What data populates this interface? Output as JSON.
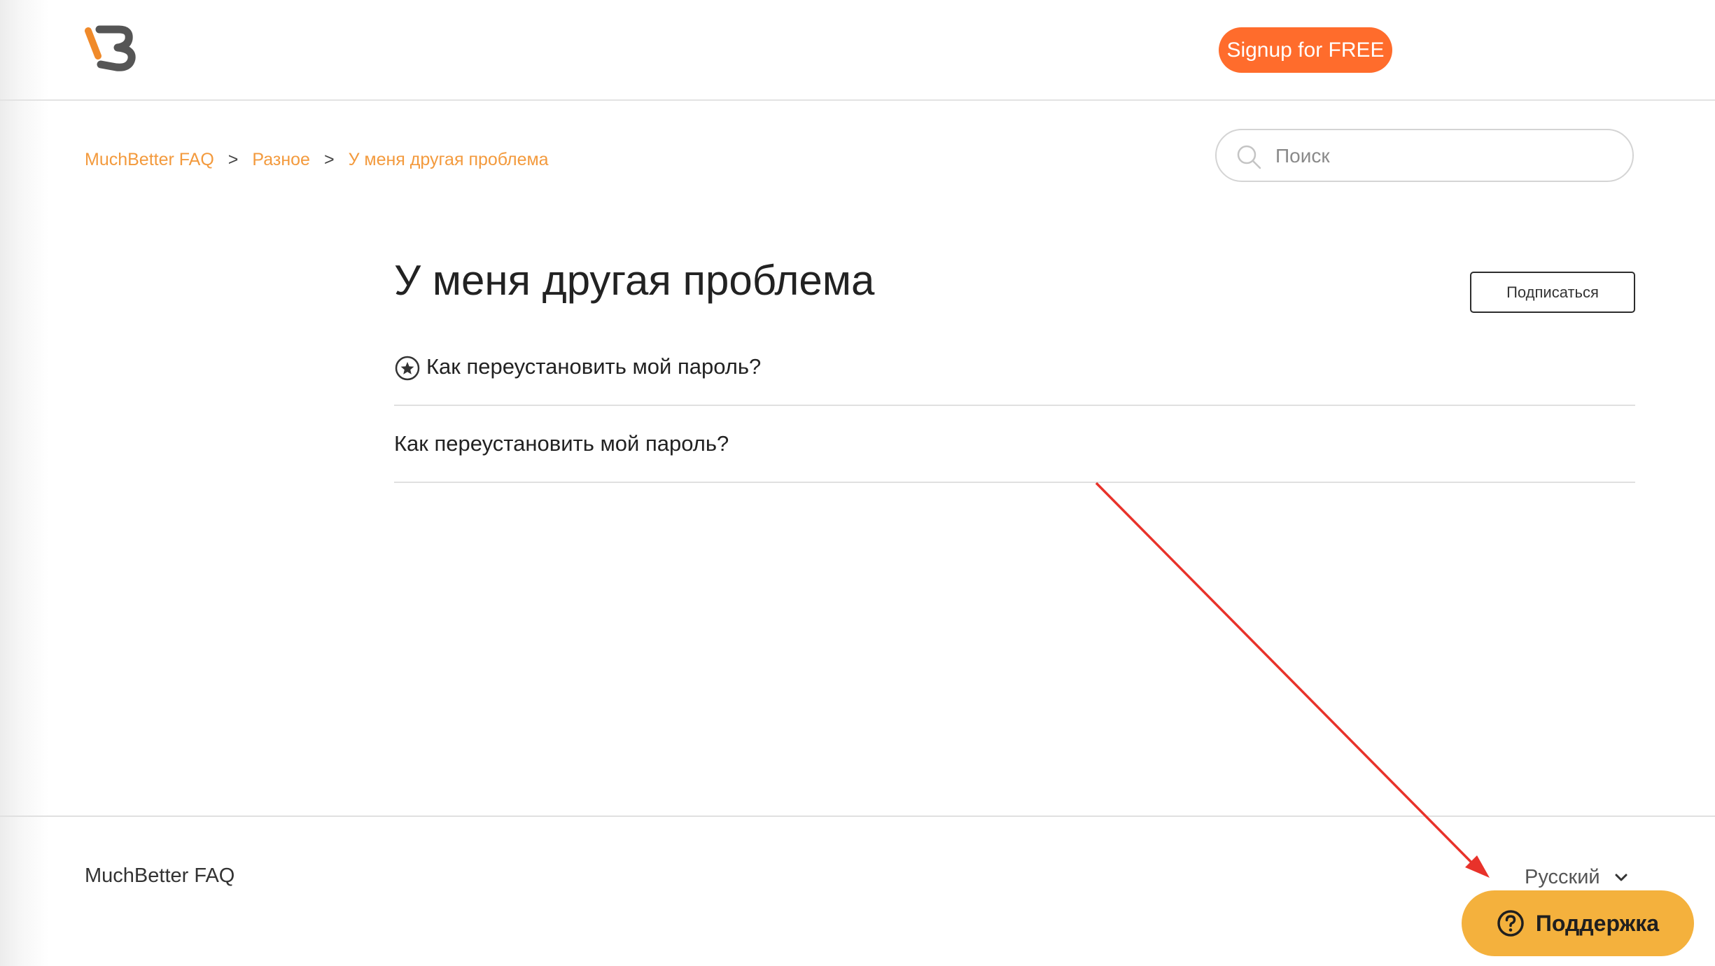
{
  "header": {
    "logo_icon": "muchbetter-logo-icon",
    "signup_label": "Signup for FREE",
    "accent_color": "#ff6c2c"
  },
  "breadcrumb": {
    "items": [
      "MuchBetter FAQ",
      "Разное",
      "У меня другая проблема"
    ],
    "separator": ">"
  },
  "search": {
    "placeholder": "Поиск",
    "icon": "search-icon"
  },
  "section": {
    "title": "У меня другая проблема",
    "subscribe_label": "Подписаться"
  },
  "articles": [
    {
      "title": "Как переустановить мой пароль?",
      "icon": "star-icon",
      "promoted": true
    },
    {
      "title": "Как переустановить мой пароль?"
    }
  ],
  "footer": {
    "title": "MuchBetter FAQ",
    "language": "Русский"
  },
  "support": {
    "label": "Поддержка",
    "icon": "question-circle-icon",
    "color": "#f4b13d"
  },
  "annotation_color": "#e8322a"
}
